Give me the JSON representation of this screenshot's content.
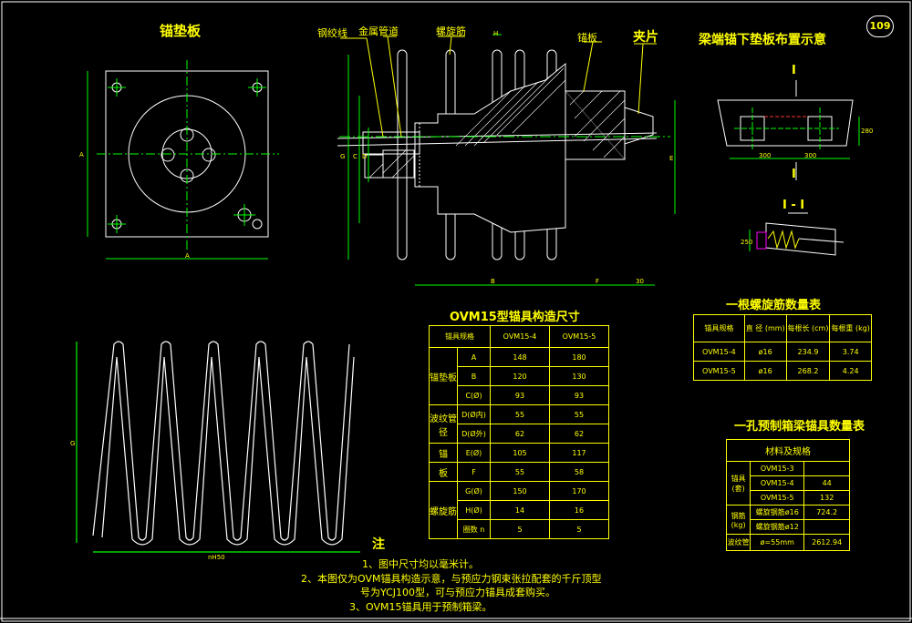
{
  "page_number": "109",
  "titles": {
    "anchor_plate": "锚垫板",
    "beam_end_layout": "梁端锚下垫板布置示意",
    "dimension_table": "OVM15型锚具构造尺寸",
    "spiral_qty_table": "一根螺旋筋数量表",
    "box_beam_qty_table": "一孔预制箱梁锚具数量表"
  },
  "callouts": {
    "strand": "钢绞线",
    "metal_duct": "金属管道",
    "spiral_bar": "螺旋筋",
    "anchor_plate": "锚板",
    "clip": "夹片"
  },
  "dim_labels": {
    "A": "A",
    "B": "B",
    "C": "C",
    "D": "D",
    "E": "E",
    "F": "F",
    "G": "G",
    "H": "H",
    "n150": "nH50",
    "30": "30",
    "300a": "300",
    "300b": "300",
    "280": "280",
    "250": "250"
  },
  "section_marks": {
    "I_top": "I",
    "I_bottom": "I",
    "section": "I - I"
  },
  "dimension_table": {
    "headers": [
      "锚具规格",
      "OVM15-4",
      "OVM15-5"
    ],
    "rows": [
      {
        "group": "锚垫板",
        "item": "A",
        "v1": "148",
        "v2": "180"
      },
      {
        "group": "",
        "item": "B",
        "v1": "120",
        "v2": "130"
      },
      {
        "group": "",
        "item": "C(Ø)",
        "v1": "93",
        "v2": "93"
      },
      {
        "group": "波纹管径",
        "item": "D(Ø内)",
        "v1": "55",
        "v2": "55"
      },
      {
        "group": "",
        "item": "D(Ø外)",
        "v1": "62",
        "v2": "62"
      },
      {
        "group": "锚",
        "item": "E(Ø)",
        "v1": "105",
        "v2": "117"
      },
      {
        "group": "板",
        "item": "F",
        "v1": "55",
        "v2": "58"
      },
      {
        "group": "螺旋筋",
        "item": "G(Ø)",
        "v1": "150",
        "v2": "170"
      },
      {
        "group": "",
        "item": "H(Ø)",
        "v1": "14",
        "v2": "16"
      },
      {
        "group": "",
        "item": "圈数 n",
        "v1": "5",
        "v2": "5"
      }
    ]
  },
  "spiral_qty_table": {
    "headers": [
      "锚具规格",
      "直 径 (mm)",
      "每根长 (cm)",
      "每根重 (kg)"
    ],
    "rows": [
      [
        "OVM15-4",
        "ø16",
        "234.9",
        "3.74"
      ],
      [
        "OVM15-5",
        "ø16",
        "268.2",
        "4.24"
      ]
    ]
  },
  "box_beam_qty_table": {
    "header": "材料及规格",
    "rows": [
      {
        "group": "锚具(套)",
        "name": "OVM15-3",
        "value": ""
      },
      {
        "group": "",
        "name": "OVM15-4",
        "value": "44"
      },
      {
        "group": "",
        "name": "OVM15-5",
        "value": "132"
      },
      {
        "group": "钢筋(kg)",
        "name": "螺旋钢筋ø16",
        "value": "724.2"
      },
      {
        "group": "",
        "name": "螺旋钢筋ø12",
        "value": ""
      },
      {
        "group": "波纹管",
        "name": "ø=55mm",
        "value": "2612.94"
      }
    ]
  },
  "notes": {
    "heading": "注",
    "lines": [
      "1、图中尺寸均以毫米计。",
      "2、本图仅为OVM锚具构造示意，与预应力钢束张拉配套的千斤顶型",
      "号为YCJ100型，可与预应力锚具成套购买。",
      "3、OVM15锚具用于预制箱梁。"
    ]
  }
}
